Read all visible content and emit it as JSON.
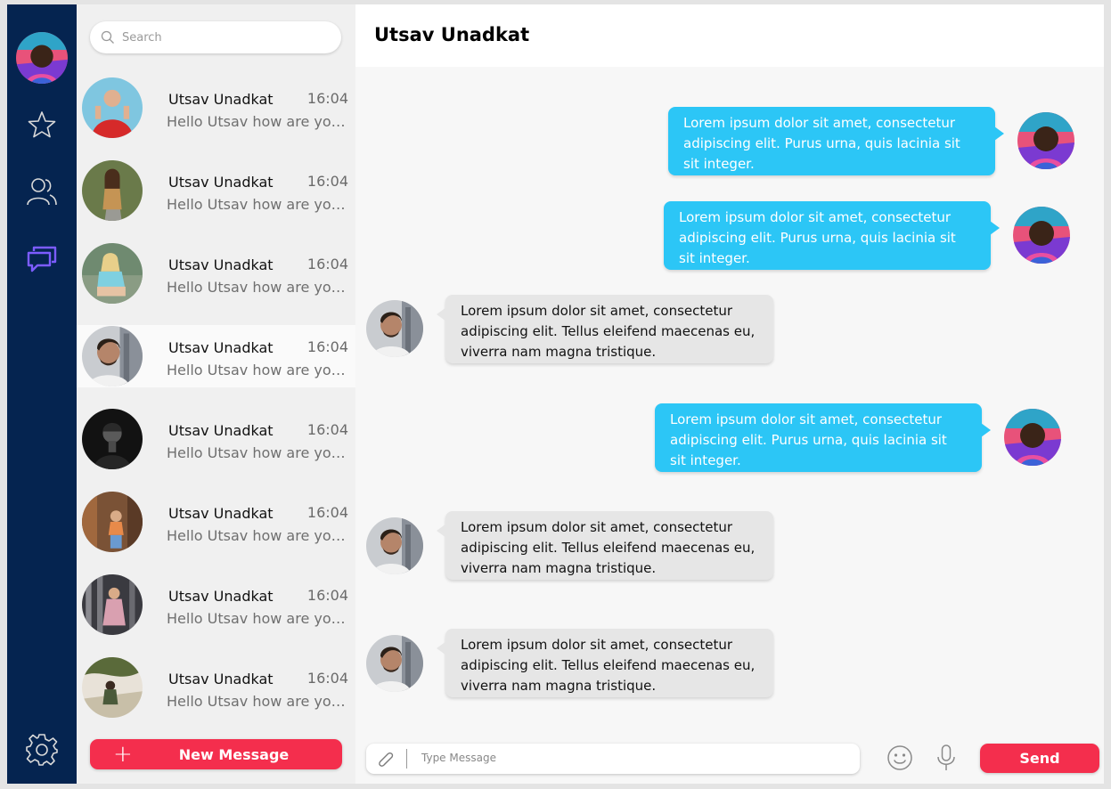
{
  "search": {
    "placeholder": "Search"
  },
  "conversations": [
    {
      "name": "Utsav Unadkat",
      "time": "16:04",
      "preview": "Hello Utsav how are you doing?",
      "active": false
    },
    {
      "name": "Utsav Unadkat",
      "time": "16:04",
      "preview": "Hello Utsav how are you doing?",
      "active": false
    },
    {
      "name": "Utsav Unadkat",
      "time": "16:04",
      "preview": "Hello Utsav how are you doing?",
      "active": false
    },
    {
      "name": "Utsav Unadkat",
      "time": "16:04",
      "preview": "Hello Utsav how are you doing?",
      "active": true
    },
    {
      "name": "Utsav Unadkat",
      "time": "16:04",
      "preview": "Hello Utsav how are you doing?",
      "active": false
    },
    {
      "name": "Utsav Unadkat",
      "time": "16:04",
      "preview": "Hello Utsav how are you doing?",
      "active": false
    },
    {
      "name": "Utsav Unadkat",
      "time": "16:04",
      "preview": "Hello Utsav how are you doing?",
      "active": false
    },
    {
      "name": "Utsav Unadkat",
      "time": "16:04",
      "preview": "Hello Utsav how are you doing?",
      "active": false
    }
  ],
  "new_message_label": "New Message",
  "chat": {
    "title": "Utsav Unadkat",
    "messages": [
      {
        "direction": "outgoing",
        "text": "Lorem ipsum dolor sit amet, consectetur adipiscing elit. Purus urna, quis lacinia sit sit integer."
      },
      {
        "direction": "outgoing",
        "text": "Lorem ipsum dolor sit amet, consectetur adipiscing elit. Purus urna, quis lacinia sit sit integer."
      },
      {
        "direction": "incoming",
        "text": "Lorem ipsum dolor sit amet, consectetur adipiscing elit. Tellus eleifend maecenas eu, viverra nam magna tristique."
      },
      {
        "direction": "outgoing",
        "text": "Lorem ipsum dolor sit amet, consectetur adipiscing elit. Purus urna, quis lacinia sit sit integer."
      },
      {
        "direction": "incoming",
        "text": "Lorem ipsum dolor sit amet, consectetur adipiscing elit. Tellus eleifend maecenas eu, viverra nam magna tristique."
      },
      {
        "direction": "incoming",
        "text": "Lorem ipsum dolor sit amet, consectetur adipiscing elit. Tellus eleifend maecenas eu, viverra nam magna tristique."
      }
    ]
  },
  "composer": {
    "placeholder": "Type Message",
    "send_label": "Send"
  },
  "colors": {
    "rail": "#052450",
    "accent_red": "#f42e4d",
    "outgoing_bubble": "#2cc6f6",
    "incoming_bubble": "#e6e6e6",
    "active_nav_icon": "#7c5cff"
  },
  "icons": {
    "rail": [
      "star-icon",
      "users-icon",
      "chat-icon",
      "gear-icon"
    ],
    "composer": [
      "paperclip-icon",
      "smiley-icon",
      "microphone-icon"
    ],
    "search": "search-icon",
    "new_message": "plus-icon"
  }
}
